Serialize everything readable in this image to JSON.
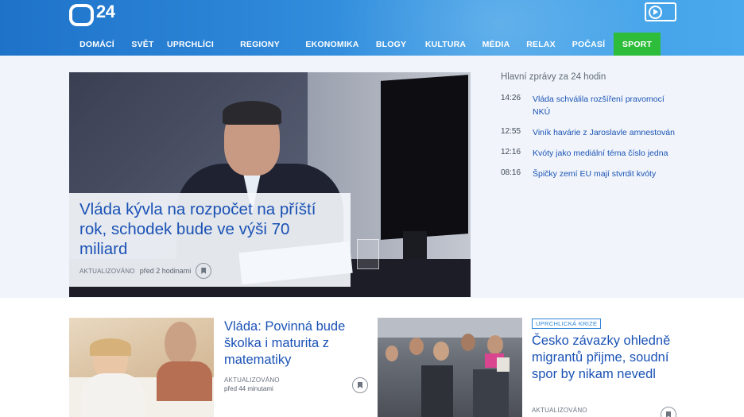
{
  "brand": {
    "logo_text": "24"
  },
  "nav": {
    "items": [
      {
        "label": "DOMÁCÍ",
        "width": 70
      },
      {
        "label": "SVĚT",
        "width": 45
      },
      {
        "label": "UPRCHLÍCI",
        "width": 75
      },
      {
        "label": "REGIONY",
        "width": 100
      },
      {
        "label": "EKONOMIKA",
        "width": 82
      },
      {
        "label": "BLOGY",
        "width": 66
      },
      {
        "label": "KULTURA",
        "width": 71
      },
      {
        "label": "MÉDIA",
        "width": 56
      },
      {
        "label": "RELAX",
        "width": 57
      },
      {
        "label": "POČASÍ",
        "width": 63
      },
      {
        "label": "SPORT",
        "width": 59
      }
    ]
  },
  "hero": {
    "title": "Vláda kývla na rozpočet na příští rok, schodek bude ve výši 70 miliard",
    "updated_label": "AKTUALIZOVÁNO",
    "time": "před 2 hodinami"
  },
  "sidebar": {
    "title": "Hlavní zprávy za 24 hodin",
    "items": [
      {
        "time": "14:26",
        "text": "Vláda schválila rozšíření pravomocí NKÚ"
      },
      {
        "time": "12:55",
        "text": "Viník havárie z Jaroslavle amnestován"
      },
      {
        "time": "12:16",
        "text": "Kvóty jako mediální téma číslo jedna"
      },
      {
        "time": "08:16",
        "text": "Špičky zemí EU mají stvrdit kvóty"
      }
    ]
  },
  "cards": [
    {
      "title": "Vláda: Povinná bude školka i maturita z matematiky",
      "updated_label": "AKTUALIZOVÁNO",
      "time": "před 44 minutami"
    },
    {
      "tag": "UPRCHLICKÁ KRIZE",
      "title": "Česko závazky ohledně migrantů přijme, soudní spor by nikam nevedl",
      "updated_label": "AKTUALIZOVÁNO"
    }
  ]
}
